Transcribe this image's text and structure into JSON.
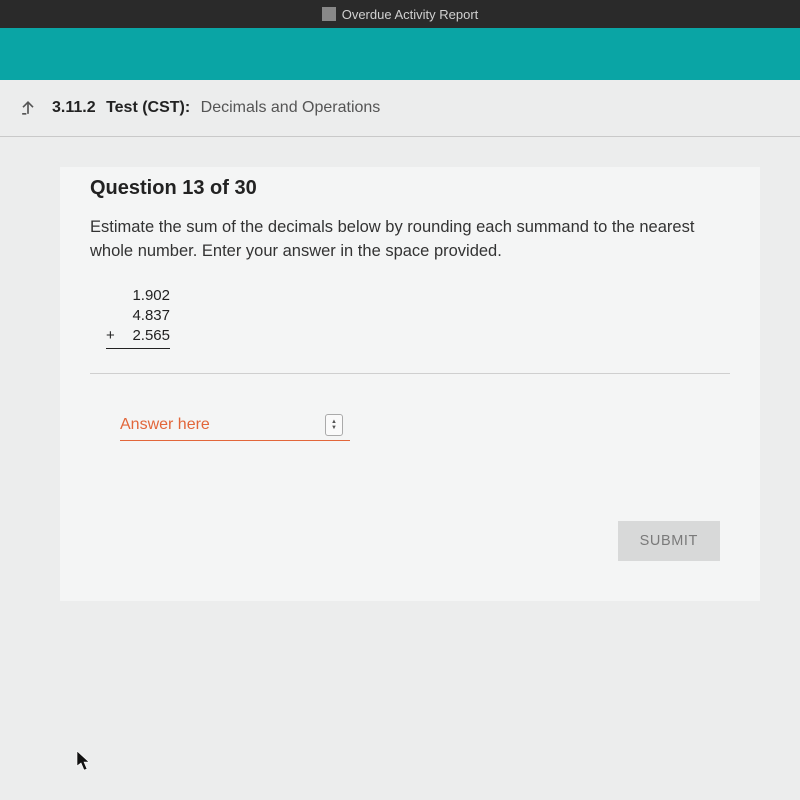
{
  "topbar": {
    "title": "Overdue Activity Report"
  },
  "header": {
    "code": "3.11.2",
    "testLabel": "Test (CST):",
    "title": "Decimals and Operations"
  },
  "question": {
    "title": "Question 13 of 30",
    "body": "Estimate the sum of the decimals below by rounding each summand to the nearest whole number. Enter your answer in the space provided.",
    "summands": [
      "1.902",
      "4.837",
      "2.565"
    ],
    "plus": "+"
  },
  "answer": {
    "placeholder": "Answer here",
    "value": ""
  },
  "buttons": {
    "submit": "SUBMIT"
  }
}
